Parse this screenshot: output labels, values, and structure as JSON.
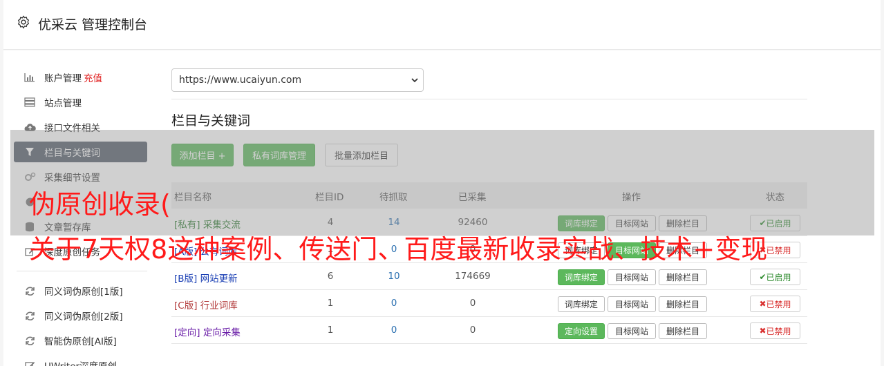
{
  "header": {
    "title": "优采云 管理控制台"
  },
  "sidebar": {
    "items": [
      {
        "label": "账户管理",
        "extra": "充值",
        "icon": "bar-chart-icon"
      },
      {
        "label": "站点管理",
        "icon": "server-icon"
      },
      {
        "label": "接口文件相关",
        "icon": "cloud-upload-icon"
      },
      {
        "label": "栏目与关键词",
        "icon": "filter-icon"
      },
      {
        "label": "采集细节设置",
        "icon": "cogs-icon"
      },
      {
        "label": "",
        "icon": "globe-icon"
      },
      {
        "label": "文章暂存库",
        "icon": "database-icon"
      },
      {
        "label": "深度原创任务",
        "icon": "edit-icon"
      },
      {
        "label": "同义词伪原创[1版]",
        "icon": "refresh-icon"
      },
      {
        "label": "同义词伪原创[2版]",
        "icon": "refresh-icon"
      },
      {
        "label": "智能伪原创[AI版]",
        "icon": "refresh-icon"
      },
      {
        "label": "UWriter深度原创",
        "icon": "edit-icon"
      }
    ]
  },
  "main": {
    "site_select": {
      "value": "https://www.ucaiyun.com"
    },
    "section_title": "栏目与关键词",
    "buttons": {
      "add_column": "添加栏目 +",
      "private_lib": "私有词库管理",
      "batch_add": "批量添加栏目"
    },
    "table": {
      "headers": {
        "name": "栏目名称",
        "id": "栏目ID",
        "pending": "待抓取",
        "collected": "已采集",
        "actions": "操作",
        "status": "状态"
      },
      "rows": [
        {
          "name": "[私有] 采集交流",
          "id": "4",
          "pending": "14",
          "collected": "92460",
          "bind": "词库绑定",
          "target": "目标网站",
          "delete": "删除栏目",
          "status": "已启用"
        },
        {
          "name": "[A版] 公有词库",
          "id": "1",
          "pending": "0",
          "collected": "0",
          "bind": "词库绑定",
          "target": "目标网站",
          "delete": "删除栏目",
          "status": "已禁用"
        },
        {
          "name": "[B版] 网站更新",
          "id": "6",
          "pending": "10",
          "collected": "174669",
          "bind": "词库绑定",
          "target": "目标网站",
          "delete": "删除栏目",
          "status": "已启用"
        },
        {
          "name": "[C版] 行业词库",
          "id": "1",
          "pending": "0",
          "collected": "0",
          "bind": "词库绑定",
          "target": "目标网站",
          "delete": "删除栏目",
          "status": "已禁用"
        },
        {
          "name": "[定向] 定向采集",
          "id": "1",
          "pending": "0",
          "collected": "0",
          "bind": "定向设置",
          "target": "目标网站",
          "delete": "删除栏目",
          "status": "已禁用"
        }
      ]
    }
  },
  "overlay": {
    "line1": "伪原创收录(",
    "line2": "关于7天权8这种案例、传送门、百度最新收录实战、技术+变现"
  },
  "colors": {
    "accent_green": "#5cb85c",
    "active_nav": "#555e6b",
    "overlay_text": "#ff1a1a",
    "disabled_red": "#d9302f"
  }
}
